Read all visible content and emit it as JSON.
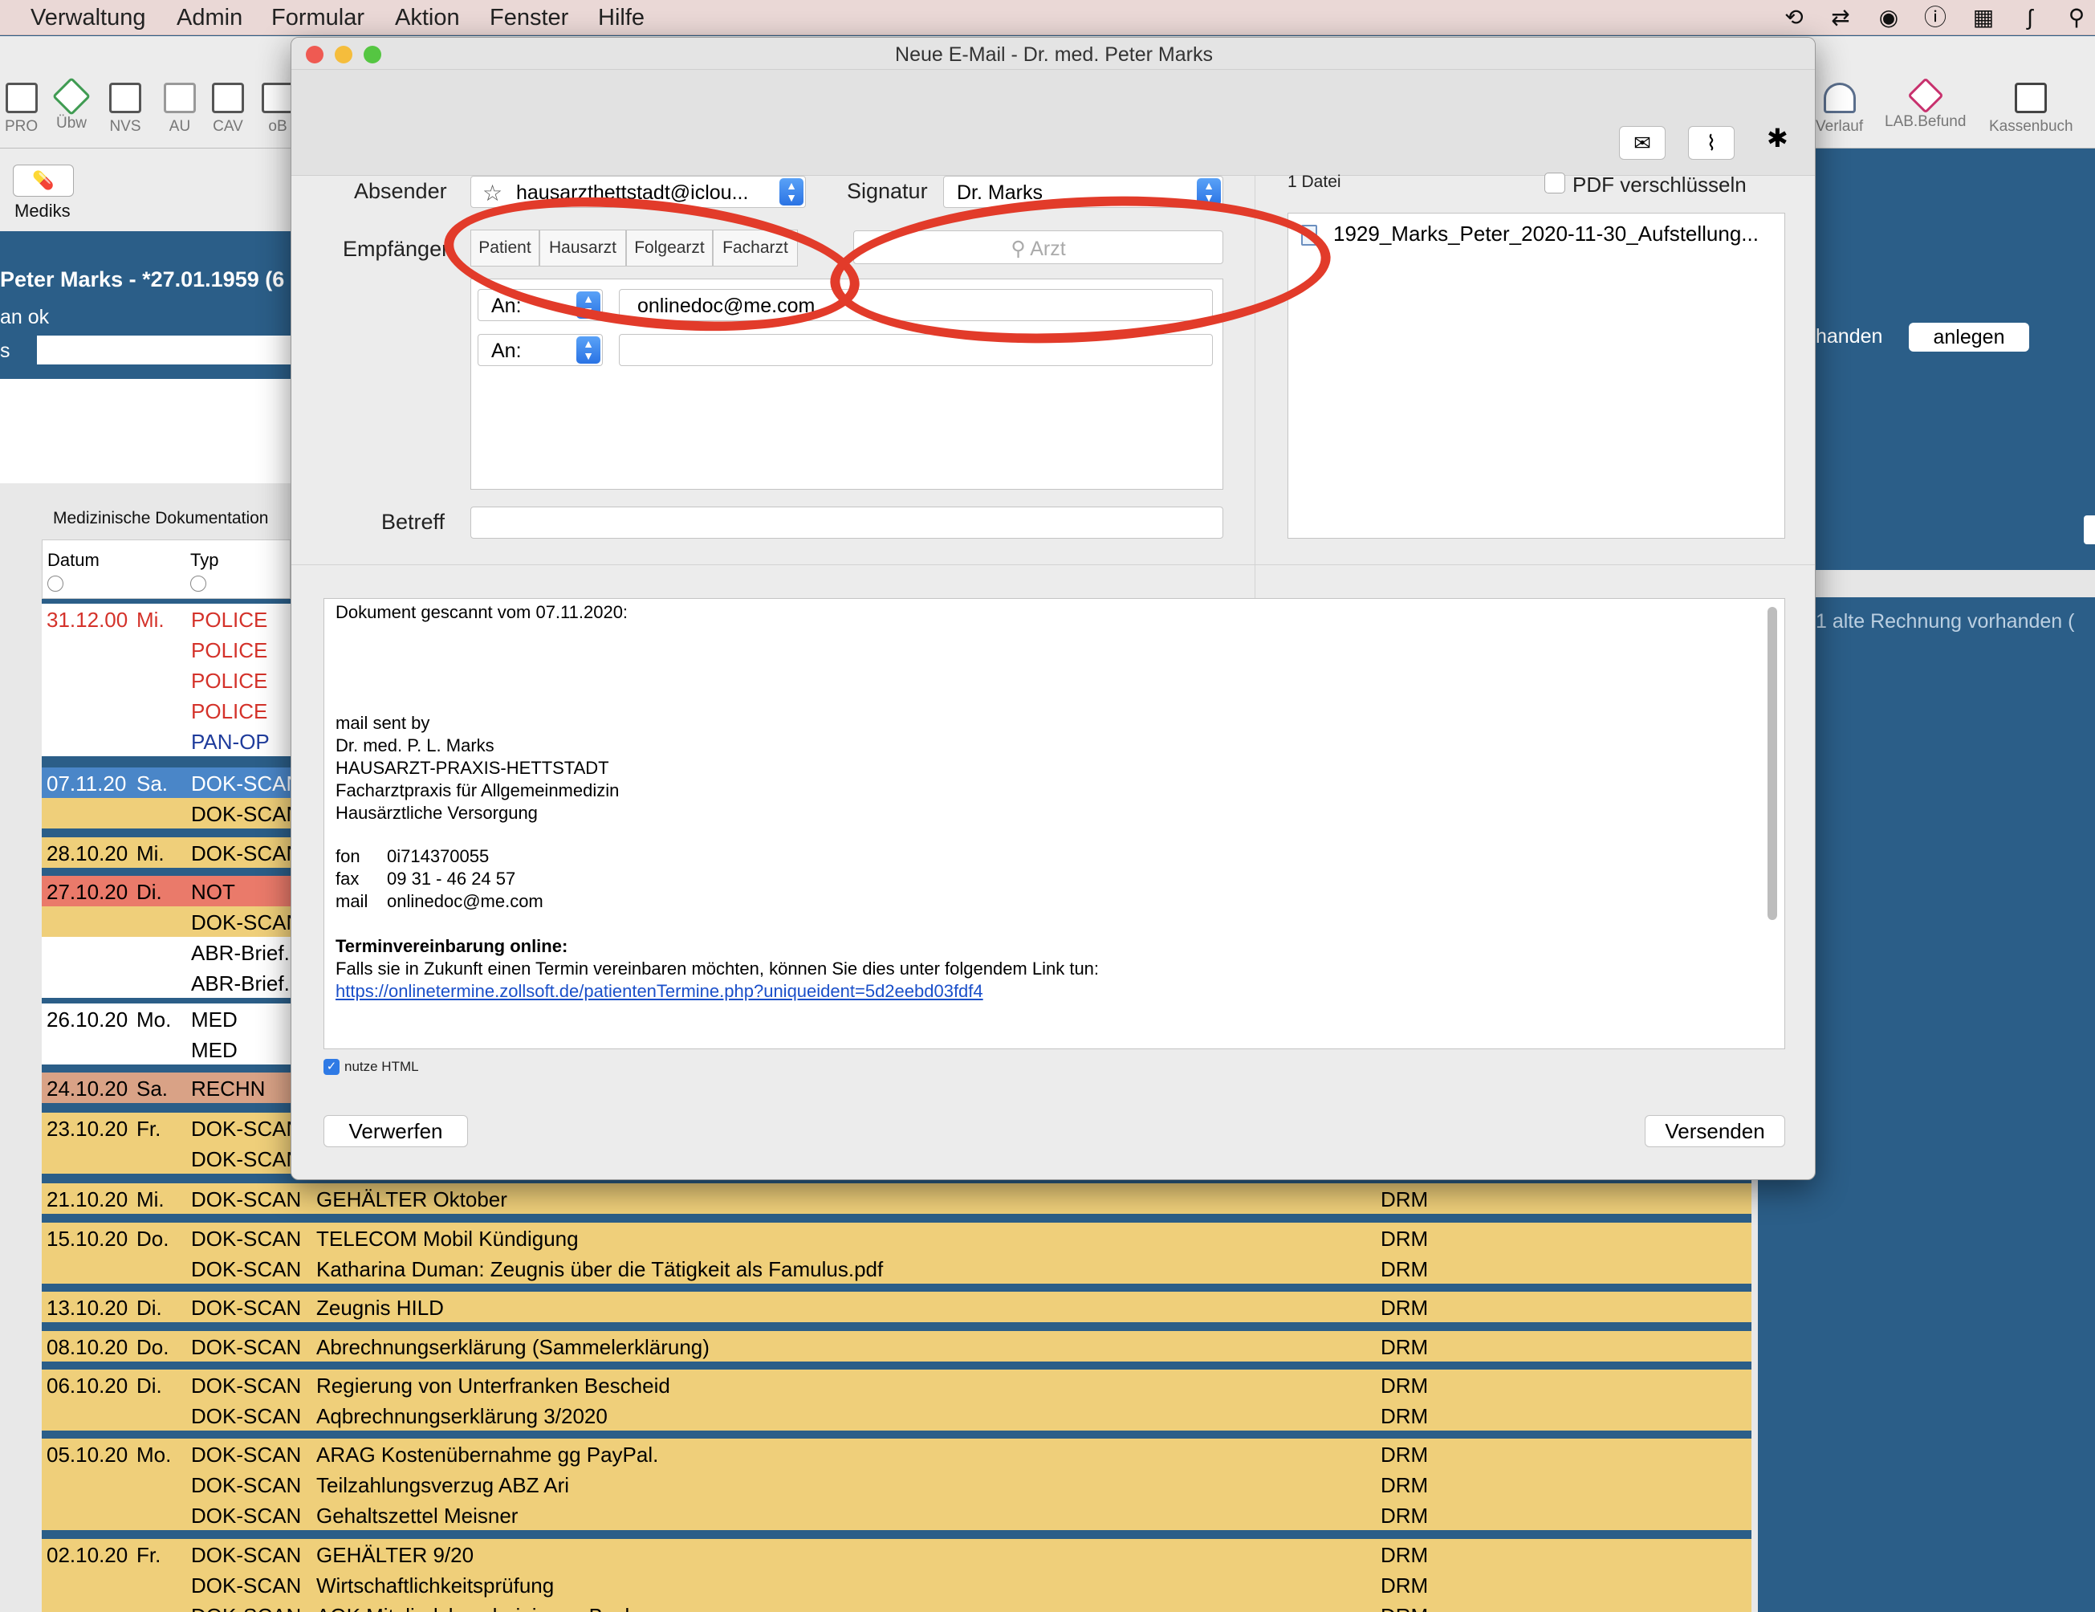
{
  "menubar": {
    "items": [
      "Verwaltung",
      "Admin",
      "Formular",
      "Aktion",
      "Fenster",
      "Hilfe"
    ]
  },
  "toolbar": {
    "left": [
      "PRO",
      "Übw",
      "NVS",
      "AU",
      "CAV",
      "oB"
    ],
    "right": [
      "Verlauf",
      "LAB.Befund",
      "Kassenbuch"
    ],
    "mediks_label": "Mediks"
  },
  "patient": {
    "name": "Peter Marks - *27.01.1959 (6",
    "status": "an ok",
    "field_label": "s",
    "anlegen_label": "anlegen",
    "vorhanden_label": "handen",
    "rechnung_hint": "1 alte Rechnung vorhanden ("
  },
  "doc_table": {
    "title": "Medizinische Dokumentation",
    "col_date": "Datum",
    "col_type": "Typ",
    "rows": [
      {
        "date": "31.12.00",
        "day": "Mi.",
        "type": "POLICE",
        "text": "",
        "user": ""
      },
      {
        "date": "",
        "day": "",
        "type": "POLICE",
        "text": "",
        "user": ""
      },
      {
        "date": "",
        "day": "",
        "type": "POLICE",
        "text": "",
        "user": ""
      },
      {
        "date": "",
        "day": "",
        "type": "POLICE",
        "text": "",
        "user": ""
      },
      {
        "date": "",
        "day": "",
        "type": "PAN-OP",
        "text": "",
        "user": ""
      },
      {
        "date": "07.11.20",
        "day": "Sa.",
        "type": "DOK-SCAN",
        "text": "",
        "user": ""
      },
      {
        "date": "",
        "day": "",
        "type": "DOK-SCAN",
        "text": "",
        "user": ""
      },
      {
        "date": "28.10.20",
        "day": "Mi.",
        "type": "DOK-SCAN",
        "text": "",
        "user": ""
      },
      {
        "date": "27.10.20",
        "day": "Di.",
        "type": "NOT",
        "text": "",
        "user": ""
      },
      {
        "date": "",
        "day": "",
        "type": "DOK-SCAN",
        "text": "",
        "user": ""
      },
      {
        "date": "",
        "day": "",
        "type": "ABR-Brief.",
        "text": "",
        "user": ""
      },
      {
        "date": "",
        "day": "",
        "type": "ABR-Brief.",
        "text": "",
        "user": ""
      },
      {
        "date": "26.10.20",
        "day": "Mo.",
        "type": "MED",
        "text": "",
        "user": ""
      },
      {
        "date": "",
        "day": "",
        "type": "MED",
        "text": "",
        "user": ""
      },
      {
        "date": "24.10.20",
        "day": "Sa.",
        "type": "RECHN",
        "text": "",
        "user": ""
      },
      {
        "date": "23.10.20",
        "day": "Fr.",
        "type": "DOK-SCAN",
        "text": "",
        "user": ""
      },
      {
        "date": "",
        "day": "",
        "type": "DOK-SCAN",
        "text": "",
        "user": ""
      },
      {
        "date": "21.10.20",
        "day": "Mi.",
        "type": "DOK-SCAN",
        "text": "GEHÄLTER Oktober",
        "user": "DRM"
      },
      {
        "date": "15.10.20",
        "day": "Do.",
        "type": "DOK-SCAN",
        "text": "TELECOM Mobil Kündigung",
        "user": "DRM"
      },
      {
        "date": "",
        "day": "",
        "type": "DOK-SCAN",
        "text": "Katharina Duman: Zeugnis über die Tätigkeit als Famulus.pdf",
        "user": "DRM"
      },
      {
        "date": "13.10.20",
        "day": "Di.",
        "type": "DOK-SCAN",
        "text": " Zeugnis HILD",
        "user": "DRM"
      },
      {
        "date": "08.10.20",
        "day": "Do.",
        "type": "DOK-SCAN",
        "text": "Abrechnungserklärung (Sammelerklärung)",
        "user": "DRM"
      },
      {
        "date": "06.10.20",
        "day": "Di.",
        "type": "DOK-SCAN",
        "text": "Regierung von Unterfranken Bescheid",
        "user": "DRM"
      },
      {
        "date": "",
        "day": "",
        "type": "DOK-SCAN",
        "text": "Aqbrechnungserklärung 3/2020",
        "user": "DRM"
      },
      {
        "date": "05.10.20",
        "day": "Mo.",
        "type": "DOK-SCAN",
        "text": "ARAG Kostenübernahme gg PayPal.",
        "user": "DRM"
      },
      {
        "date": "",
        "day": "",
        "type": "DOK-SCAN",
        "text": "Teilzahlungsverzug ABZ Ari",
        "user": "DRM"
      },
      {
        "date": "",
        "day": "",
        "type": "DOK-SCAN",
        "text": "Gehaltszettel Meisner",
        "user": "DRM"
      },
      {
        "date": "02.10.20",
        "day": "Fr.",
        "type": "DOK-SCAN",
        "text": "GEHÄLTER 9/20",
        "user": "DRM"
      },
      {
        "date": "",
        "day": "",
        "type": "DOK-SCAN",
        "text": "Wirtschaftlichkeitsprüfung",
        "user": "DRM"
      },
      {
        "date": "",
        "day": "",
        "type": "DOK-SCAN",
        "text": "AOK Mitgliedsbescheinigung Beck",
        "user": "DRM"
      }
    ]
  },
  "dialog": {
    "title": "Neue E-Mail - Dr. med. Peter Marks",
    "sender_label": "Absender",
    "sender_value": "hausarzthettstadt@iclou...",
    "signature_label": "Signatur",
    "signature_value": "Dr. Marks",
    "recipient_label": "Empfänger",
    "segments": [
      "Patient",
      "Hausarzt",
      "Folgearzt",
      "Facharzt"
    ],
    "search_placeholder": "Arzt",
    "recipients": [
      {
        "kind": "An:",
        "address": "onlinedoc@me.com"
      },
      {
        "kind": "An:",
        "address": ""
      }
    ],
    "subject_label": "Betreff",
    "subject_value": "",
    "attachments_count": "1 Datei",
    "pdf_encrypt_label": "PDF verschlüsseln",
    "attachment_name": "1929_Marks_Peter_2020-11-30_Aufstellung...",
    "body": {
      "line1": "Dokument gescannt vom 07.11.2020:",
      "line2": "mail sent by",
      "line3": "Dr. med. P. L. Marks",
      "line4": "HAUSARZT-PRAXIS-HETTSTADT",
      "line5": "Facharztpraxis für Allgemeinmedizin",
      "line6": "Hausärztliche Versorgung",
      "fon_label": "fon",
      "fon_value": "0i714370055",
      "fax_label": "fax",
      "fax_value": "09 31 - 46 24 57",
      "mail_label": "mail",
      "mail_value": "onlinedoc@me.com",
      "bold_heading": "Terminvereinbarung online:",
      "info": "Falls sie in Zukunft einen Termin vereinbaren möchten, können Sie dies unter folgendem Link tun:",
      "link": "https://onlinetermine.zollsoft.de/patientenTermine.php?uniqueident=5d2eebd03fdf4"
    },
    "html_label": "nutze HTML",
    "discard_label": "Verwerfen",
    "send_label": "Versenden"
  },
  "colors": {
    "accent": "#2a73e4",
    "annotation": "#e23b2a",
    "row_yellow": "#efcf7a",
    "row_selected": "#4a86c8",
    "row_red": "#ea7a6a",
    "row_salmon": "#d9a286",
    "police_text": "#d4322a",
    "panop_text": "#1f3c9c"
  }
}
